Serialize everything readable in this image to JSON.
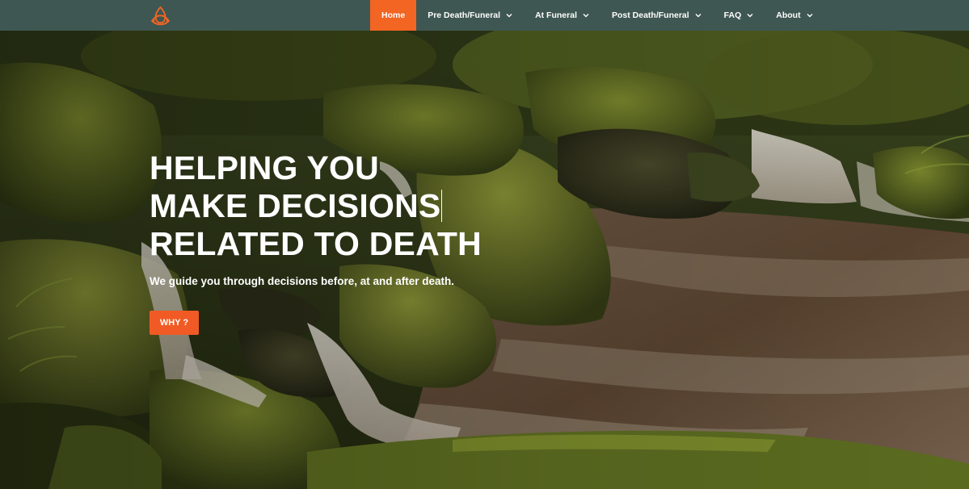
{
  "navbar": {
    "logo_icon": "triquetra-knot-icon",
    "logo_color": "#f26522",
    "background": "#3f5752",
    "active_color": "#f26522",
    "items": [
      {
        "label": "Home",
        "active": true,
        "has_dropdown": false
      },
      {
        "label": "Pre Death/Funeral",
        "active": false,
        "has_dropdown": true
      },
      {
        "label": "At Funeral",
        "active": false,
        "has_dropdown": true
      },
      {
        "label": "Post Death/Funeral",
        "active": false,
        "has_dropdown": true
      },
      {
        "label": "FAQ",
        "active": false,
        "has_dropdown": true
      },
      {
        "label": "About",
        "active": false,
        "has_dropdown": true
      }
    ]
  },
  "hero": {
    "headline_lines": [
      "HELPING YOU",
      "MAKE DECISIONS",
      "RELATED TO DEATH"
    ],
    "subheadline": "We guide you through decisions before, at and after death.",
    "cta_label": "WHY ?",
    "cta_color": "#f15a24"
  }
}
